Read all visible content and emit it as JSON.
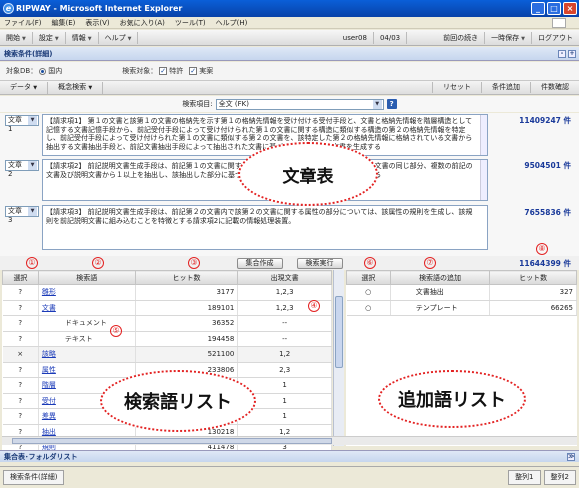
{
  "window": {
    "title": "RIPWAY - Microsoft Internet Explorer",
    "minimize": "_",
    "maximize": "□",
    "close": "×"
  },
  "menu": [
    "ファイル(F)",
    "編集(E)",
    "表示(V)",
    "お気に入り(A)",
    "ツール(T)",
    "ヘルプ(H)"
  ],
  "toolbar": {
    "left": [
      "開始",
      "設定",
      "情報",
      "ヘルプ"
    ],
    "user": "user08",
    "page": "04/03",
    "right": [
      "前回の続き",
      "一時保存",
      "ログアウト"
    ]
  },
  "panel": {
    "title": "検索条件(詳細)"
  },
  "options": {
    "target_db_label": "対象DB：",
    "target_db_value": "国内",
    "search_target_label": "検索対象：",
    "targets": [
      "特許",
      "実案"
    ]
  },
  "actions": {
    "left": [
      "データ",
      "概念検索"
    ],
    "right": [
      "リセット",
      "条件追加",
      "件数確認"
    ]
  },
  "field": {
    "label": "検索項目:",
    "value": "全文 (FK)",
    "help": "?"
  },
  "documents": [
    {
      "select": "文章1",
      "text": "【請求項1】 第１の文書と該第１の文書の格納先を示す第１の格納先情報を受け付ける受付手段と、文書と格納先情報を階層構造として記憶する文書記憶手段から、前記受付手段によって受け付けられた第１の文書に関する構造に類似する構造の第２の格納先情報を特定し、前記受付手段によって受け付けられた第１の文書に類似する第２の文書を、該特定した第２の格納先情報に格納されている文書から抽出する文書抽出手段と、前記文書抽出手段によって抽出された文書に基づいて前記第１の文書を生成する",
      "count": "11409247 件"
    },
    {
      "select": "文章2",
      "text": "【請求項2】 前記説明文書生成手段は、前記第１の文書に関する属性と対応する部分、複数の前記第２の文書の同じ部分、複数の前記の文書及び説明文書から１以上を抽出し、該抽出した部分に基づいて、説明文書を生成することを特徴とする",
      "count": "9504501 件"
    },
    {
      "select": "文章3",
      "text": "【請求項3】 前記説明文書生成手段は、前記第２の文書内で該第２の文書に関する属性の部分については、該属性の規則を生成し、該規則を前記説明文書に組み込むことを特徴とする請求項2に記載の情報処理装置。",
      "count": "7655836 件"
    }
  ],
  "callouts": {
    "document_table": "文章表",
    "search_term_list": "検索語リスト",
    "added_term_list": "追加語リスト"
  },
  "markers": [
    "①",
    "②",
    "③",
    "④",
    "⑤",
    "⑥",
    "⑦",
    "⑧"
  ],
  "buttons": {
    "combine": "集合作成",
    "execute": "検索実行"
  },
  "total": "11644399 件",
  "left_table": {
    "headers": [
      "選択",
      "検索語",
      "ヒット数",
      "出現文書"
    ],
    "rows": [
      {
        "sel": "?",
        "term": "雛形",
        "hits": "3177",
        "docs": "1,2,3",
        "link": true
      },
      {
        "sel": "?",
        "term": "文書",
        "hits": "189101",
        "docs": "1,2,3",
        "link": true
      },
      {
        "sel": "?",
        "term": "ドキュメント",
        "hits": "36352",
        "docs": "--",
        "link": false,
        "sub": true
      },
      {
        "sel": "?",
        "term": "テキスト",
        "hits": "194458",
        "docs": "--",
        "link": false,
        "sub": true
      },
      {
        "sel": "×",
        "term": "該略",
        "hits": "521100",
        "docs": "1,2",
        "link": true
      },
      {
        "sel": "?",
        "term": "属性",
        "hits": "233806",
        "docs": "2,3",
        "link": true
      },
      {
        "sel": "?",
        "term": "階層",
        "hits": "",
        "docs": "1",
        "link": true
      },
      {
        "sel": "?",
        "term": "受付",
        "hits": "",
        "docs": "1",
        "link": true
      },
      {
        "sel": "?",
        "term": "差異",
        "hits": "",
        "docs": "1",
        "link": true
      },
      {
        "sel": "?",
        "term": "抽出",
        "hits": "130218",
        "docs": "1,2",
        "link": true
      },
      {
        "sel": "?",
        "term": "規則",
        "hits": "411478",
        "docs": "3",
        "link": true
      }
    ]
  },
  "right_table": {
    "headers": [
      "選択",
      "検索語の追加",
      "ヒット数"
    ],
    "rows": [
      {
        "sel": "○",
        "term": "文書抽出",
        "hits": "327"
      },
      {
        "sel": "○",
        "term": "テンプレート",
        "hits": "66265"
      }
    ]
  },
  "foldbar": {
    "title": "集合表･フォルダリスト",
    "icon": "≫"
  },
  "status": {
    "left": "検索条件(詳細)",
    "right": [
      "整列1",
      "整列2"
    ]
  },
  "colors": {
    "titlebar": "#0842a8",
    "callout_border": "#e32222",
    "count_text": "#1a3a9a",
    "link": "#1a3ab8"
  }
}
